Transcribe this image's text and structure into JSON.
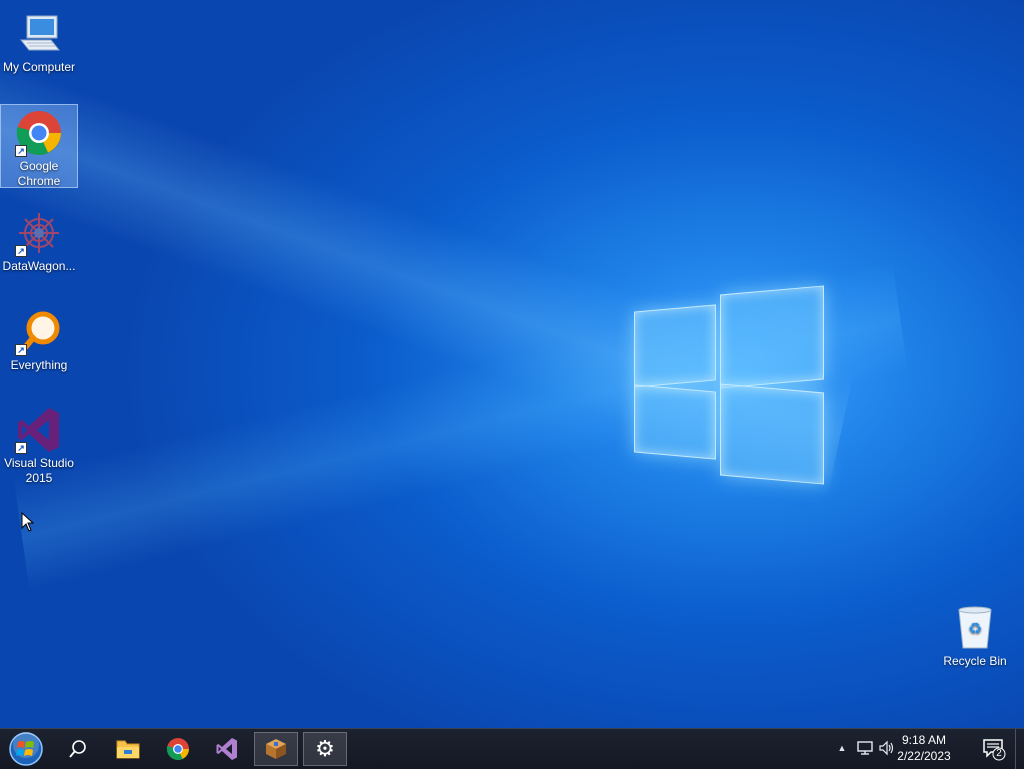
{
  "desktop": {
    "icons": [
      {
        "label": "My Computer",
        "icon": "computer-icon"
      },
      {
        "label": "Google\nChrome",
        "icon": "chrome-icon"
      },
      {
        "label": "DataWagon...",
        "icon": "datawagon-icon"
      },
      {
        "label": "Everything",
        "icon": "everything-search-icon"
      },
      {
        "label": "Visual Studio\n2015",
        "icon": "visual-studio-icon"
      },
      {
        "label": "Recycle Bin",
        "icon": "recycle-bin-icon"
      }
    ],
    "selected_icon": "Google Chrome"
  },
  "taskbar": {
    "items": [
      {
        "name": "start-button",
        "icon": "windows-orb-icon"
      },
      {
        "name": "search-button",
        "icon": "search-icon"
      },
      {
        "name": "file-explorer",
        "icon": "folder-icon"
      },
      {
        "name": "chrome",
        "icon": "chrome-icon"
      },
      {
        "name": "visual-studio",
        "icon": "visual-studio-icon"
      },
      {
        "name": "package-app",
        "icon": "package-icon",
        "active": true
      },
      {
        "name": "settings",
        "icon": "gear-icon",
        "active": true
      }
    ],
    "tray": {
      "chevron": "▲",
      "time": "9:18 AM",
      "date": "2/22/2023",
      "notification_count": "2"
    }
  },
  "colors": {
    "desktop_blue": "#0b5ccc",
    "taskbar": "#141823",
    "vs_purple": "#68217a"
  }
}
